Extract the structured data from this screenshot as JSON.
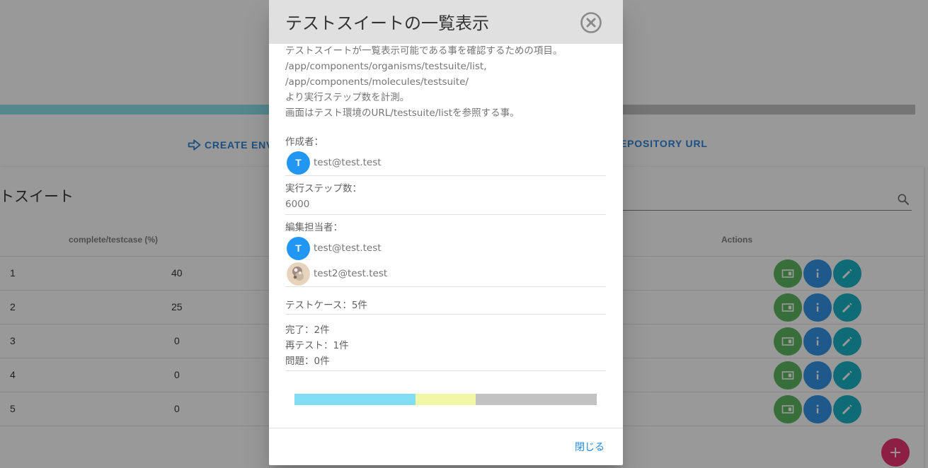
{
  "background": {
    "progress_percent": 40,
    "links": {
      "create_env": "CREATE ENV",
      "repository_url": "EPOSITORY URL"
    },
    "card_title": "ストスイート",
    "table": {
      "columns": [
        "complete/testcase (%)",
        "Actions"
      ],
      "rows": [
        {
          "no": "1",
          "percent": "40"
        },
        {
          "no": "2",
          "percent": "25"
        },
        {
          "no": "3",
          "percent": "0"
        },
        {
          "no": "4",
          "percent": "0"
        },
        {
          "no": "5",
          "percent": "0"
        }
      ]
    },
    "add_button": "+"
  },
  "dialog": {
    "title": "テストスイートの一覧表示",
    "description": [
      "テストスイートが一覧表示可能である事を確認するための項目。",
      "/app/components/organisms/testsuite/list,",
      "/app/components/molecules/testsuite/",
      "より実行ステップ数を計測。",
      "画面はテスト環境のURL/testsuite/listを参照する事。"
    ],
    "author": {
      "label": "作成者：",
      "users": [
        {
          "initial": "T",
          "email": "test@test.test"
        }
      ]
    },
    "steps": {
      "label": "実行ステップ数：",
      "value": "6000"
    },
    "editors": {
      "label": "編集担当者：",
      "users": [
        {
          "initial": "T",
          "email": "test@test.test"
        },
        {
          "initial": "",
          "email": "test2@test.test"
        }
      ]
    },
    "testcases": "テストケース：5件",
    "status": {
      "done": "完了：2件",
      "retest": "再テスト：1件",
      "issues": "問題：0件"
    },
    "progress": {
      "done_count": 2,
      "retest_count": 1,
      "remaining_count": 2,
      "colors": {
        "done": "#81def5",
        "retest": "#f2f7a6",
        "remaining": "#c2c2c2"
      }
    },
    "close_button": "閉じる"
  }
}
